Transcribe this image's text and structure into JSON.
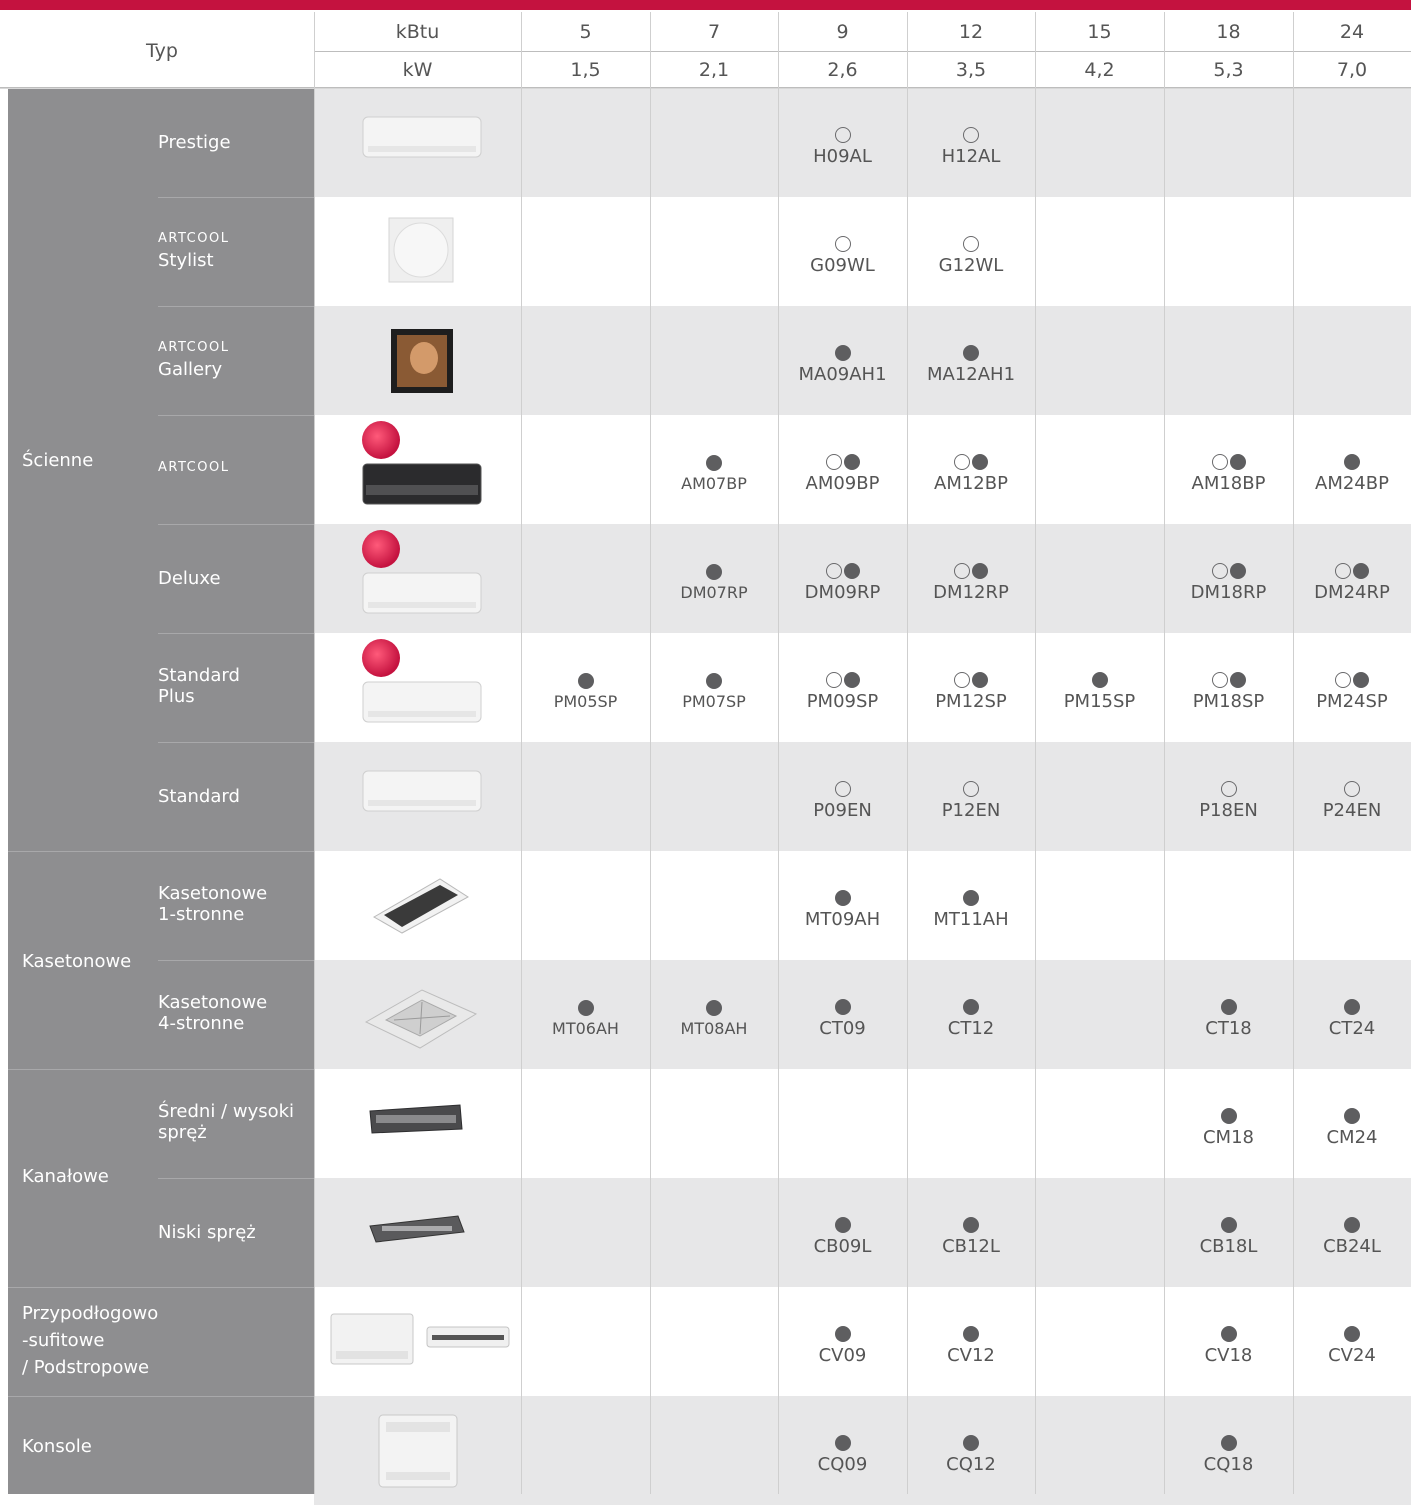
{
  "header": {
    "typ_label": "Typ",
    "kbtu_label": "kBtu",
    "kw_label": "kW",
    "columns": [
      {
        "kbtu": "5",
        "kw": "1,5"
      },
      {
        "kbtu": "7",
        "kw": "2,1"
      },
      {
        "kbtu": "9",
        "kw": "2,6"
      },
      {
        "kbtu": "12",
        "kw": "3,5"
      },
      {
        "kbtu": "15",
        "kw": "4,2"
      },
      {
        "kbtu": "18",
        "kw": "5,3"
      },
      {
        "kbtu": "24",
        "kw": "7,0"
      }
    ]
  },
  "categories": [
    {
      "label": "Ścienne"
    },
    {
      "label": "Kasetonowe"
    },
    {
      "label": "Kanałowe"
    },
    {
      "label": "Przypodłogowo\n-sufitowe\n/ Podstropowe"
    },
    {
      "label": "Konsole"
    }
  ],
  "rows": [
    {
      "brand": "",
      "label": "Prestige",
      "image": "wall-unit-white-icon",
      "cells": [
        null,
        null,
        {
          "model": "H09AL",
          "dots": [
            "empty"
          ]
        },
        {
          "model": "H12AL",
          "dots": [
            "empty"
          ]
        },
        null,
        null,
        null
      ]
    },
    {
      "brand": "ARTCOOL",
      "label": "Stylist",
      "image": "square-round-panel-icon",
      "cells": [
        null,
        null,
        {
          "model": "G09WL",
          "dots": [
            "empty"
          ]
        },
        {
          "model": "G12WL",
          "dots": [
            "empty"
          ]
        },
        null,
        null,
        null
      ]
    },
    {
      "brand": "ARTCOOL",
      "label": "Gallery",
      "image": "picture-frame-unit-icon",
      "cells": [
        null,
        null,
        {
          "model": "MA09AH1",
          "dots": [
            "filled"
          ]
        },
        {
          "model": "MA12AH1",
          "dots": [
            "filled"
          ]
        },
        null,
        null,
        null
      ]
    },
    {
      "brand": "ARTCOOL",
      "label": "",
      "image": "wall-unit-black-icon",
      "badge": true,
      "cells": [
        null,
        {
          "model": "AM07BP",
          "dots": [
            "filled"
          ],
          "small": true
        },
        {
          "model": "AM09BP",
          "dots": [
            "empty",
            "filled"
          ]
        },
        {
          "model": "AM12BP",
          "dots": [
            "empty",
            "filled"
          ]
        },
        null,
        {
          "model": "AM18BP",
          "dots": [
            "empty",
            "filled"
          ]
        },
        {
          "model": "AM24BP",
          "dots": [
            "filled"
          ]
        }
      ]
    },
    {
      "brand": "",
      "label": "Deluxe",
      "image": "wall-unit-white-icon",
      "badge": true,
      "cells": [
        null,
        {
          "model": "DM07RP",
          "dots": [
            "filled"
          ],
          "small": true
        },
        {
          "model": "DM09RP",
          "dots": [
            "empty",
            "filled"
          ]
        },
        {
          "model": "DM12RP",
          "dots": [
            "empty",
            "filled"
          ]
        },
        null,
        {
          "model": "DM18RP",
          "dots": [
            "empty",
            "filled"
          ]
        },
        {
          "model": "DM24RP",
          "dots": [
            "empty",
            "filled"
          ]
        }
      ]
    },
    {
      "brand": "",
      "label": "Standard\nPlus",
      "image": "wall-unit-white-icon",
      "badge": true,
      "cells": [
        {
          "model": "PM05SP",
          "dots": [
            "filled"
          ],
          "small": true
        },
        {
          "model": "PM07SP",
          "dots": [
            "filled"
          ],
          "small": true
        },
        {
          "model": "PM09SP",
          "dots": [
            "empty",
            "filled"
          ]
        },
        {
          "model": "PM12SP",
          "dots": [
            "empty",
            "filled"
          ]
        },
        {
          "model": "PM15SP",
          "dots": [
            "filled"
          ]
        },
        {
          "model": "PM18SP",
          "dots": [
            "empty",
            "filled"
          ]
        },
        {
          "model": "PM24SP",
          "dots": [
            "empty",
            "filled"
          ]
        }
      ]
    },
    {
      "brand": "",
      "label": "Standard",
      "image": "wall-unit-white-icon",
      "cells": [
        null,
        null,
        {
          "model": "P09EN",
          "dots": [
            "empty"
          ]
        },
        {
          "model": "P12EN",
          "dots": [
            "empty"
          ]
        },
        null,
        {
          "model": "P18EN",
          "dots": [
            "empty"
          ]
        },
        {
          "model": "P24EN",
          "dots": [
            "empty"
          ]
        }
      ]
    },
    {
      "brand": "",
      "label": "Kasetonowe\n1-stronne",
      "image": "one-way-cassette-icon",
      "cells": [
        null,
        null,
        {
          "model": "MT09AH",
          "dots": [
            "filled"
          ]
        },
        {
          "model": "MT11AH",
          "dots": [
            "filled"
          ]
        },
        null,
        null,
        null
      ]
    },
    {
      "brand": "",
      "label": "Kasetonowe\n4-stronne",
      "image": "four-way-cassette-icon",
      "cells": [
        {
          "model": "MT06AH",
          "dots": [
            "filled"
          ],
          "small": true
        },
        {
          "model": "MT08AH",
          "dots": [
            "filled"
          ],
          "small": true
        },
        {
          "model": "CT09",
          "dots": [
            "filled"
          ]
        },
        {
          "model": "CT12",
          "dots": [
            "filled"
          ]
        },
        null,
        {
          "model": "CT18",
          "dots": [
            "filled"
          ]
        },
        {
          "model": "CT24",
          "dots": [
            "filled"
          ]
        }
      ]
    },
    {
      "brand": "",
      "label": "Średni / wysoki\nspręż",
      "image": "duct-unit-icon",
      "cells": [
        null,
        null,
        null,
        null,
        null,
        {
          "model": "CM18",
          "dots": [
            "filled"
          ]
        },
        {
          "model": "CM24",
          "dots": [
            "filled"
          ]
        }
      ]
    },
    {
      "brand": "",
      "label": "Niski spręż",
      "image": "low-duct-unit-icon",
      "cells": [
        null,
        null,
        {
          "model": "CB09L",
          "dots": [
            "filled"
          ]
        },
        {
          "model": "CB12L",
          "dots": [
            "filled"
          ]
        },
        null,
        {
          "model": "CB18L",
          "dots": [
            "filled"
          ]
        },
        {
          "model": "CB24L",
          "dots": [
            "filled"
          ]
        }
      ]
    },
    {
      "brand": "",
      "label": "",
      "image": "ceiling-floor-unit-icon",
      "cells": [
        null,
        null,
        {
          "model": "CV09",
          "dots": [
            "filled"
          ]
        },
        {
          "model": "CV12",
          "dots": [
            "filled"
          ]
        },
        null,
        {
          "model": "CV18",
          "dots": [
            "filled"
          ]
        },
        {
          "model": "CV24",
          "dots": [
            "filled"
          ]
        }
      ]
    },
    {
      "brand": "",
      "label": "",
      "image": "console-unit-icon",
      "cells": [
        null,
        null,
        {
          "model": "CQ09",
          "dots": [
            "filled"
          ]
        },
        {
          "model": "CQ12",
          "dots": [
            "filled"
          ]
        },
        null,
        {
          "model": "CQ18",
          "dots": [
            "filled"
          ]
        },
        null
      ]
    }
  ]
}
